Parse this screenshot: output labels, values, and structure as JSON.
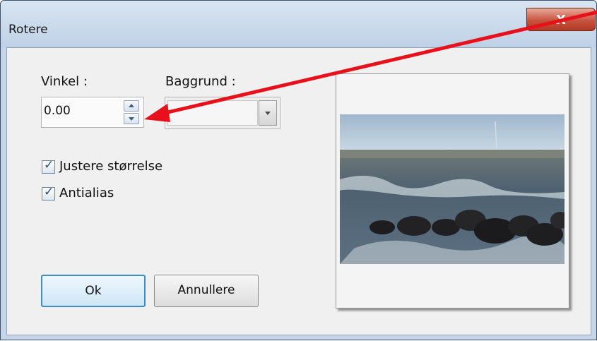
{
  "dialog": {
    "title": "Rotere",
    "close_glyph": "X"
  },
  "angle": {
    "label": "Vinkel :",
    "value": "0.00"
  },
  "background": {
    "label": "Baggrund :",
    "selected": ""
  },
  "options": [
    {
      "label": "Justere størrelse",
      "checked": true
    },
    {
      "label": "Antialias",
      "checked": true
    }
  ],
  "buttons": {
    "ok": "Ok",
    "cancel": "Annullere"
  },
  "icons": {
    "close": "close-icon",
    "spin_up": "spin-up-icon",
    "spin_down": "spin-down-icon",
    "dropdown": "chevron-down-icon",
    "check": "checkmark-icon"
  },
  "colors": {
    "annotation_arrow": "#e8101a",
    "ok_focus_border": "#3d8dc6",
    "close_button": "#c7543f"
  }
}
